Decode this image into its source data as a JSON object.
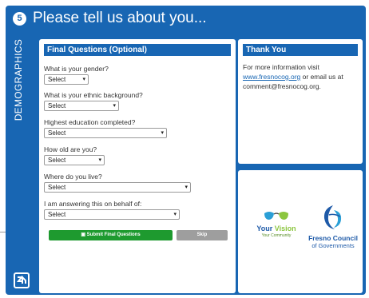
{
  "header": {
    "step": "5",
    "title": "Please tell us about you..."
  },
  "sidebar": {
    "label": "DEMOGRAPHICS"
  },
  "final_questions": {
    "heading": "Final Questions (Optional)",
    "questions": [
      {
        "label": "What is your gender?",
        "value": "Select"
      },
      {
        "label": "What is your ethnic background?",
        "value": "Select"
      },
      {
        "label": "Highest education completed?",
        "value": "Select"
      },
      {
        "label": "How old are you?",
        "value": "Select"
      },
      {
        "label": "Where do you live?",
        "value": "Select"
      },
      {
        "label": "I am answering this on behalf of:",
        "value": "Select"
      }
    ],
    "submit_label": "Submit Final Questions",
    "skip_label": "Skip"
  },
  "thank_you": {
    "heading": "Thank You",
    "text_before_link": "For more information visit ",
    "link_text": "www.fresnocog.org",
    "text_after_link": " or email us at comment@fresnocog.org."
  },
  "logos": {
    "your_vision_line1_a": "Your ",
    "your_vision_line1_b": "Vision",
    "your_vision_line2": "Your Community",
    "fresno_line1": "Fresno Council",
    "fresno_line2": "of Governments"
  },
  "colors": {
    "brand_blue": "#1866b3",
    "submit_green": "#1e9a2f",
    "skip_gray": "#9e9e9e"
  }
}
